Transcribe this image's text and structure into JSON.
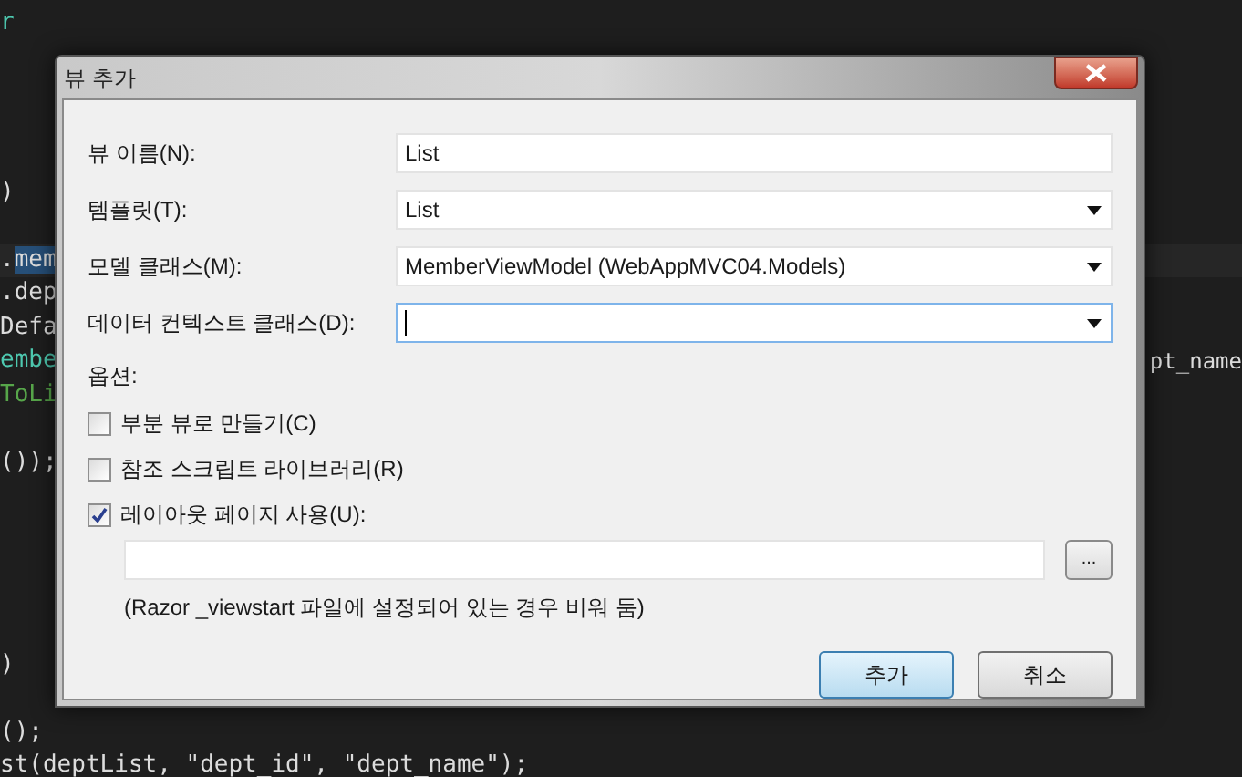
{
  "editor": {
    "lines": [
      {
        "segments": [
          {
            "text": "r",
            "selected": false
          }
        ],
        "color": "#4ec9b0"
      },
      {
        "segments": [
          {
            "text": ")",
            "selected": false
          }
        ],
        "color": "#dcdcdc"
      },
      {
        "segments": [
          {
            "text": ".",
            "selected": false
          },
          {
            "text": "mem",
            "selected": true
          }
        ]
      },
      {
        "segments": [
          {
            "text": ".dep",
            "selected": false
          }
        ],
        "color": "#dcdcdc"
      },
      {
        "segments": [
          {
            "text": "Defa",
            "selected": false
          }
        ],
        "color": "#dcdcdc"
      },
      {
        "segments": [
          {
            "text": "embe",
            "selected": false
          }
        ],
        "color": "#4ec9b0",
        "right": "pt_name"
      },
      {
        "segments": [
          {
            "text": "ToLi",
            "selected": false
          }
        ],
        "color": "#57a64a"
      },
      {
        "segments": [
          {
            "text": "());",
            "selected": false
          }
        ],
        "color": "#dcdcdc"
      },
      {
        "segments": [
          {
            "text": ")",
            "selected": false
          }
        ],
        "color": "#dcdcdc"
      },
      {
        "segments": [
          {
            "text": "();",
            "selected": false
          }
        ],
        "color": "#dcdcdc"
      },
      {
        "segments": [
          {
            "text": "st(deptList, \"dept_id\", \"dept_name\");",
            "selected": false
          }
        ],
        "color": "#dcdcdc"
      }
    ]
  },
  "dialog": {
    "title": "뷰 추가",
    "fields": [
      {
        "kind": "text",
        "label": "뷰 이름(N):",
        "value": "List",
        "focused": false
      },
      {
        "kind": "combo",
        "label": "템플릿(T):",
        "value": "List",
        "focused": false
      },
      {
        "kind": "combo",
        "label": "모델 클래스(M):",
        "value": "MemberViewModel (WebAppMVC04.Models)",
        "focused": false
      },
      {
        "kind": "combo",
        "label": "데이터 컨텍스트 클래스(D):",
        "focused": true
      }
    ],
    "options_label": "옵션:",
    "options": [
      {
        "label": "부분 뷰로 만들기(C)",
        "checked": false
      },
      {
        "label": "참조 스크립트 라이브러리(R)",
        "checked": false
      },
      {
        "label": "레이아웃 페이지 사용(U):",
        "checked": true
      }
    ],
    "layout_path": {
      "browse": "...",
      "note": "(Razor _viewstart 파일에 설정되어 있는 경우 비워 둠)"
    },
    "buttons": [
      {
        "label": "추가",
        "default": true
      },
      {
        "label": "취소",
        "default": false
      }
    ]
  }
}
